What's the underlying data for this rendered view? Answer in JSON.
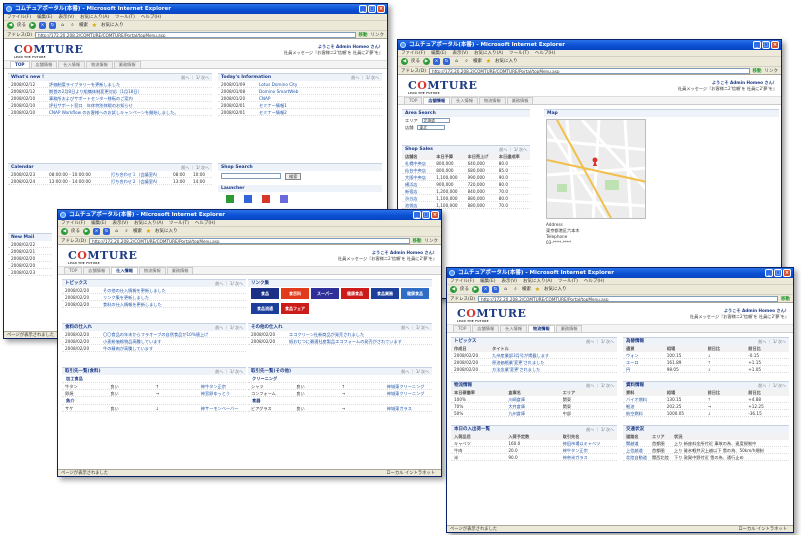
{
  "common": {
    "ie_title": "コムチュアポータル(本番) - Microsoft Internet Explorer",
    "menu": [
      "ファイル(F)",
      "編集(E)",
      "表示(V)",
      "お気に入り(A)",
      "ツール(T)",
      "ヘルプ(H)"
    ],
    "toolbar": {
      "back": "戻る",
      "search": "検索",
      "favorites": "お気に入り"
    },
    "address_label": "アドレス(D)",
    "url": "http://172.20.208.2/COMTURE/COMTURE/Portal/topMenu.asp",
    "go": "移動",
    "links": "リンク",
    "status_done": "ページが表示されました",
    "status_zone": "ローカル イントラネット",
    "logo_text_pre": "C",
    "logo_text_o": "O",
    "logo_text_post": "MTURE",
    "logo_tag": "LEAD THE FUTURE",
    "welcome_line1": "ようこそ Admin Homeo さん！",
    "welcome_line2": "社員メッセージ『お客様ニ2'信頼'を 社員に2'夢'を』",
    "tabs": [
      "TOP",
      "店舗情報",
      "仕入情報",
      "物流情報",
      "業務情報"
    ],
    "pager": "前へ ｜ 1/ 次へ",
    "colors": {
      "title_blue": "#0a4fd2",
      "brand": "#1d3a84",
      "accent_red": "#d8352b"
    }
  },
  "win1": {
    "whats_new_title": "What's new !",
    "whats_new": [
      {
        "date": "2008/02/12",
        "text": "評価制度ライブラリーを更新しました"
      },
      {
        "date": "2008/02/12",
        "text": "期首の2月8日より組織体制変更対応（1月18日）"
      },
      {
        "date": "2008/02/10",
        "text": "事務所およびサポートセンター移転のご案内"
      },
      {
        "date": "2008/02/10",
        "text": "評社サポート窓口　年休特別休暇のお知らせ"
      },
      {
        "date": "2008/02/10",
        "text": "CNAP Workflow のお客様へのお試しキャンペーンを開始しました。"
      }
    ],
    "today_title": "Today's Information",
    "today": [
      {
        "date": "2008/01/09",
        "text": "Lotus Domino City"
      },
      {
        "date": "2008/01/08",
        "text": "Domino SmartWeb"
      },
      {
        "date": "2008/01/20",
        "text": "CNAP"
      },
      {
        "date": "2008/02/01",
        "text": "セミナー情報1"
      },
      {
        "date": "2008/02/01",
        "text": "セミナー情報2"
      }
    ],
    "calendar_title": "Calendar",
    "calendar": [
      {
        "date": "2008/02/23",
        "time": "08:00:00 - 10:00:00",
        "text": "打ち合わせ１（会議室A）",
        "a": "08:00",
        "b": "10:00"
      },
      {
        "date": "2008/02/24",
        "time": "13:00:00 - 14:00:00",
        "text": "打ち合わせ２（会議室A）",
        "a": "13:00",
        "b": "14:00"
      }
    ],
    "shop_search_title": "Shop Search",
    "search_button": "検索",
    "launcher_title": "Launcher",
    "newmail_title": "New Mail",
    "newmail_dates": [
      "2008/02/22",
      "2008/02/21",
      "2008/02/20",
      "2008/02/20",
      "2008/02/23"
    ]
  },
  "win2": {
    "area_search_title": "Area Search",
    "area_label": "エリア",
    "area_value": "北海道",
    "branch_label": "店舗",
    "branch_value": "東北",
    "map_title": "Map",
    "shop_sales_title": "Shop Sales",
    "headers": [
      "店舗名",
      "本日予算",
      "本日売上げ",
      "本日達成率"
    ],
    "rows": [
      [
        "札幌中央店",
        "800,000",
        "640,000",
        "80.0"
      ],
      [
        "仙台中央店",
        "800,000",
        "680,000",
        "85.0"
      ],
      [
        "大阪中央店",
        "1,100,000",
        "990,000",
        "90.0"
      ],
      [
        "横浜店",
        "900,000",
        "720,000",
        "80.0"
      ],
      [
        "新宿店",
        "1,200,000",
        "840,000",
        "70.0"
      ],
      [
        "渋谷店",
        "1,100,000",
        "880,000",
        "80.0"
      ],
      [
        "池袋店",
        "1,100,000",
        "880,000",
        "70.0"
      ]
    ],
    "address_label": "Address",
    "address_value": "東京都港区六本木",
    "tel_label": "Telephone",
    "tel_value": "03-****-****"
  },
  "win3": {
    "topics_title": "トピックス",
    "topics": [
      {
        "date": "2008/02/20",
        "text": "その他の仕入情報を更新しました"
      },
      {
        "date": "2008/02/20",
        "text": "リンク集を更新しました"
      },
      {
        "date": "2008/02/20",
        "text": "食料の仕入情報を更新しました"
      }
    ],
    "links_title": "リンク集",
    "banners": [
      {
        "text": "食品",
        "color": "#1b2f86"
      },
      {
        "text": "食百科",
        "color": "#e13b1c"
      },
      {
        "text": "スーパー",
        "color": "#2f2f9a"
      },
      {
        "text": "健康食品",
        "color": "#cc1b1b"
      },
      {
        "text": "食品業務",
        "color": "#1d3f9c"
      },
      {
        "text": "健康食品",
        "color": "#2e6cc6"
      },
      {
        "text": "食品流通",
        "color": "#1d3f9c"
      },
      {
        "text": "食品フェア",
        "color": "#cc1b1b"
      }
    ],
    "food_title": "食料の仕入れ",
    "food": [
      {
        "date": "2008/02/20",
        "text": "〇〇食品の年末からフラオーブの自然食品が10%値上げ"
      },
      {
        "date": "2008/02/20",
        "text": "小麦粉価格物品高騰しています"
      },
      {
        "date": "2008/02/20",
        "text": "牛の精肉が高騰しています"
      }
    ],
    "other_title": "その他の仕入れ",
    "other": [
      {
        "date": "2008/02/20",
        "text": "エコクリーン社新商品が発売されました"
      },
      {
        "date": "2008/02/20",
        "text": "紙おむつに最適社産製品エコフォームの発売がされています"
      }
    ],
    "supplier_food_title": "取引先一覧(食料)",
    "supplier_other_title": "取引先一覧(その他)",
    "cat_food1": "加工食品",
    "food_sup1": [
      [
        "牛タン",
        "良い",
        "↑",
        "神牛タン正宗"
      ],
      [
        "卵焼",
        "良い",
        "→",
        "神宮卵ゆっとう"
      ]
    ],
    "cat_food2": "魚介",
    "food_sup2": [
      [
        "サケ",
        "良い",
        "↓",
        "神サーモンベーバー"
      ]
    ],
    "cat_other1": "クリーニング",
    "other_sup1": [
      [
        "シャツ",
        "良い",
        "↑",
        "神城東クリーニング"
      ],
      [
        "コンフォーム",
        "良い",
        "→",
        "神城東クリーニング"
      ]
    ],
    "cat_other2": "食器",
    "other_sup2": [
      [
        "ビアグラス",
        "良い",
        "→",
        "神城東ガラス"
      ]
    ]
  },
  "win4": {
    "topics_title": "トピックス",
    "topics_headers": [
      "作成日",
      "タイトル"
    ],
    "topics": [
      {
        "date": "2008/02/20",
        "text": "九州産業部3月号が掲載します"
      },
      {
        "date": "2008/02/20",
        "text": "原油価格業'変更'されました"
      },
      {
        "date": "2008/02/20",
        "text": "方法金業'変更'されました"
      }
    ],
    "fx_title": "為替情報",
    "fx_headers": [
      "通貨",
      "相場",
      "前日比",
      "前日比"
    ],
    "fx": [
      [
        "ウォン",
        "100.15",
        "↓",
        "-0.15"
      ],
      [
        "ユーロ",
        "161.89",
        "↑",
        "+1.15"
      ],
      [
        "円",
        "98.05",
        "↓",
        "+1.05"
      ]
    ],
    "logistics_title": "物流情報",
    "logistics_headers": [
      "本日稼働率",
      "倉庫名",
      "エリア"
    ],
    "logistics": [
      [
        "100%",
        "川崎倉庫",
        "関東"
      ],
      [
        "70%",
        "大井倉庫",
        "関東"
      ],
      [
        "50%",
        "九州倉庫",
        "中部"
      ]
    ],
    "price_title": "資料情報",
    "price_headers": [
      "資料",
      "相場",
      "前日比",
      "前日比"
    ],
    "prices": [
      [
        "バイオ燃料",
        "130.15",
        "↑",
        "+4.88"
      ],
      [
        "軽油",
        "202.25",
        "→",
        "+12.25"
      ],
      [
        "航空燃料",
        "1000.05",
        "↓",
        "-36.15"
      ]
    ],
    "arrival_title": "本日の入出荷一覧",
    "arrival_headers": [
      "入荷品目",
      "入荷予定数",
      "取引先名"
    ],
    "arrivals": [
      [
        "キャベツ",
        "160.0",
        "神田市場以キャベツ"
      ],
      [
        "牛肉",
        "20.0",
        "神牛タン正宗"
      ],
      [
        "米",
        "90.0",
        "神奈米ガラス"
      ]
    ],
    "traffic_title": "交通状況",
    "traffic_headers": [
      "道路名",
      "エリア",
      "状況"
    ],
    "traffic": [
      [
        "関越道",
        "首都圏",
        "上り 新座料金所付近 事故の為、速度規制中"
      ],
      [
        "上信越道",
        "首都圏",
        "上り 碓氷軽井沢上越以下 雪の為、50km/h規制"
      ],
      [
        "北陸自動道",
        "関西北陸",
        "下り 敦賀中野付近 雪の為、通行止め"
      ]
    ]
  }
}
